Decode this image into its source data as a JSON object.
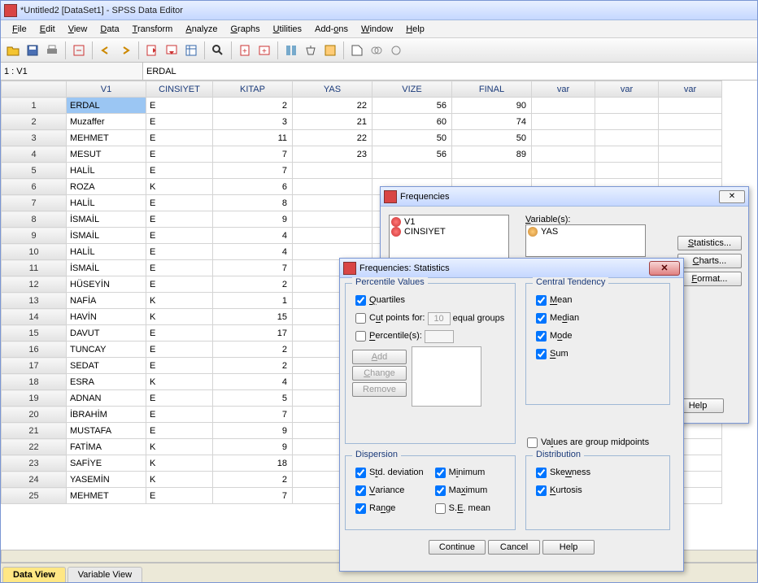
{
  "app": {
    "title": "*Untitled2 [DataSet1] - SPSS Data Editor"
  },
  "menubar": [
    "File",
    "Edit",
    "View",
    "Data",
    "Transform",
    "Analyze",
    "Graphs",
    "Utilities",
    "Add-ons",
    "Window",
    "Help"
  ],
  "locbar": {
    "cell": "1 : V1",
    "value": "ERDAL"
  },
  "columns": [
    "V1",
    "CINSIYET",
    "KITAP",
    "YAS",
    "VIZE",
    "FINAL",
    "var",
    "var",
    "var"
  ],
  "rows": [
    [
      "ERDAL",
      "E",
      "2",
      "22",
      "56",
      "90"
    ],
    [
      "Muzaffer",
      "E",
      "3",
      "21",
      "60",
      "74"
    ],
    [
      "MEHMET",
      "E",
      "11",
      "22",
      "50",
      "50"
    ],
    [
      "MESUT",
      "E",
      "7",
      "23",
      "56",
      "89"
    ],
    [
      "HALİL",
      "E",
      "7",
      "",
      "",
      ""
    ],
    [
      "ROZA",
      "K",
      "6",
      "",
      "",
      ""
    ],
    [
      "HALİL",
      "E",
      "8",
      "",
      "",
      ""
    ],
    [
      "İSMAİL",
      "E",
      "9",
      "",
      "",
      ""
    ],
    [
      "İSMAİL",
      "E",
      "4",
      "",
      "",
      ""
    ],
    [
      "HALİL",
      "E",
      "4",
      "",
      "",
      ""
    ],
    [
      "İSMAİL",
      "E",
      "7",
      "",
      "",
      ""
    ],
    [
      "HÜSEYİN",
      "E",
      "2",
      "",
      "",
      ""
    ],
    [
      "NAFİA",
      "K",
      "1",
      "",
      "",
      ""
    ],
    [
      "HAVİN",
      "K",
      "15",
      "",
      "",
      ""
    ],
    [
      "DAVUT",
      "E",
      "17",
      "",
      "",
      ""
    ],
    [
      "TUNCAY",
      "E",
      "2",
      "",
      "",
      ""
    ],
    [
      "SEDAT",
      "E",
      "2",
      "",
      "",
      ""
    ],
    [
      "ESRA",
      "K",
      "4",
      "",
      "",
      ""
    ],
    [
      "ADNAN",
      "E",
      "5",
      "",
      "",
      ""
    ],
    [
      "İBRAHİM",
      "E",
      "7",
      "",
      "",
      ""
    ],
    [
      "MUSTAFA",
      "E",
      "9",
      "",
      "",
      ""
    ],
    [
      "FATİMA",
      "K",
      "9",
      "",
      "",
      ""
    ],
    [
      "SAFİYE",
      "K",
      "18",
      "",
      "",
      ""
    ],
    [
      "YASEMİN",
      "K",
      "2",
      "",
      "",
      ""
    ],
    [
      "MEHMET",
      "E",
      "7",
      "",
      "",
      ""
    ]
  ],
  "bottom_tabs": {
    "data_view": "Data View",
    "variable_view": "Variable View"
  },
  "freq_dialog": {
    "title": "Frequencies",
    "left_list": [
      "V1",
      "CINSIYET"
    ],
    "vars_label": "Variable(s):",
    "vars_list": [
      "YAS"
    ],
    "buttons": {
      "stats": "Statistics...",
      "charts": "Charts...",
      "format": "Format...",
      "help": "Help"
    }
  },
  "stats_dialog": {
    "title": "Frequencies: Statistics",
    "groups": {
      "percentile": "Percentile Values",
      "central": "Central Tendency",
      "dispersion": "Dispersion",
      "distribution": "Distribution"
    },
    "percentile": {
      "quartiles": "Quartiles",
      "cut": "Cut points for:",
      "cut_val": "10",
      "cut_suffix": "equal groups",
      "perc": "Percentile(s):",
      "add": "Add",
      "change": "Change",
      "remove": "Remove"
    },
    "central": {
      "mean": "Mean",
      "median": "Median",
      "mode": "Mode",
      "sum": "Sum"
    },
    "midpoints": "Values are group midpoints",
    "dispersion": {
      "std": "Std. deviation",
      "variance": "Variance",
      "range": "Range",
      "min": "Minimum",
      "max": "Maximum",
      "se": "S.E. mean"
    },
    "distribution": {
      "skew": "Skewness",
      "kurt": "Kurtosis"
    },
    "buttons": {
      "continue": "Continue",
      "cancel": "Cancel",
      "help": "Help"
    }
  }
}
